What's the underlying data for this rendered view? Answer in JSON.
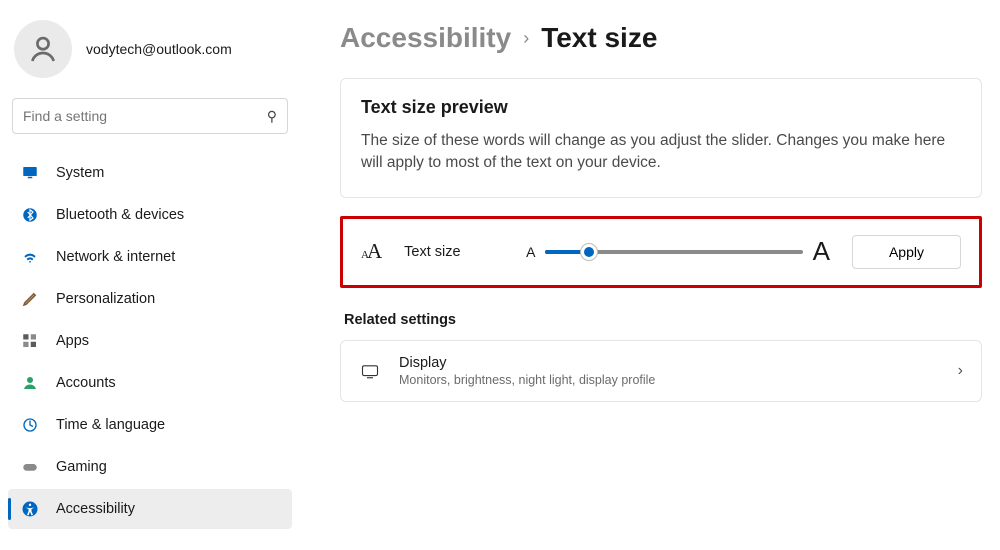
{
  "user": {
    "email": "vodytech@outlook.com"
  },
  "search": {
    "placeholder": "Find a setting"
  },
  "sidebar": {
    "items": [
      {
        "label": "System"
      },
      {
        "label": "Bluetooth & devices"
      },
      {
        "label": "Network & internet"
      },
      {
        "label": "Personalization"
      },
      {
        "label": "Apps"
      },
      {
        "label": "Accounts"
      },
      {
        "label": "Time & language"
      },
      {
        "label": "Gaming"
      },
      {
        "label": "Accessibility"
      }
    ]
  },
  "breadcrumb": {
    "parent": "Accessibility",
    "current": "Text size"
  },
  "preview": {
    "title": "Text size preview",
    "description": "The size of these words will change as you adjust the slider. Changes you make here will apply to most of the text on your device."
  },
  "text_size": {
    "label": "Text size",
    "small_glyph": "A",
    "large_glyph": "A",
    "apply_label": "Apply"
  },
  "related": {
    "heading": "Related settings",
    "display": {
      "title": "Display",
      "subtitle": "Monitors, brightness, night light, display profile"
    }
  }
}
